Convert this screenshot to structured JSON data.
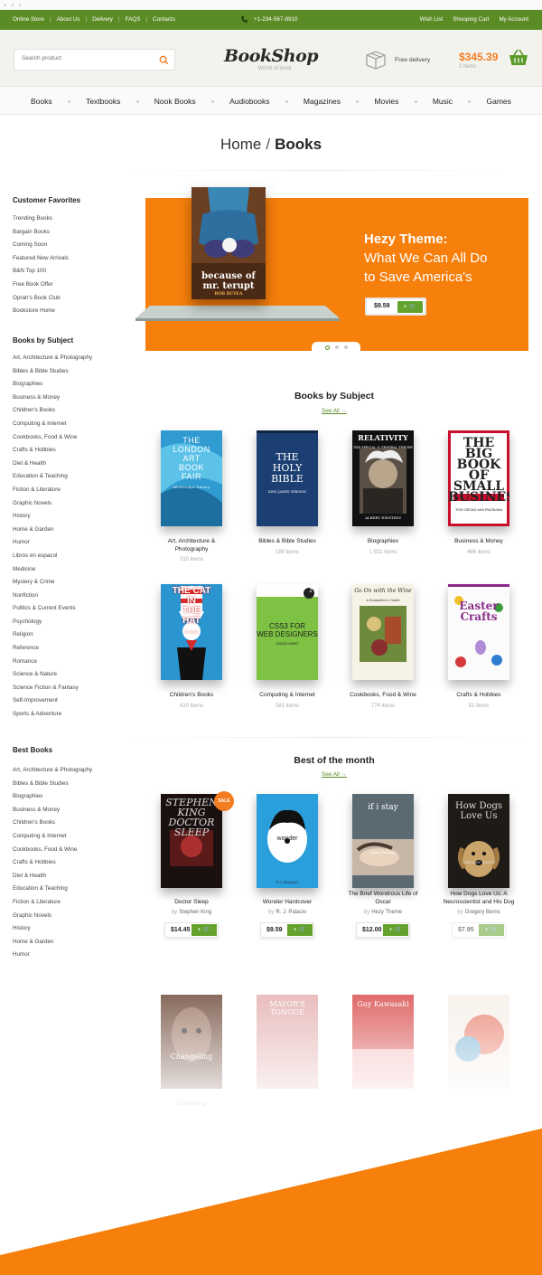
{
  "topbar": {
    "links": [
      "Online Store",
      "About Us",
      "Delivery",
      "FAQS",
      "Contacts"
    ],
    "phone": "+1-234-567-8910",
    "account_links": [
      "Wish List",
      "Shooping Cart",
      "My Account"
    ]
  },
  "header": {
    "search_placeholder": "Search product",
    "logo": "BookShop",
    "tagline": "World of book",
    "delivery_text": "Free delivery",
    "cart_total": "$345.39",
    "cart_count": "2 items"
  },
  "nav": [
    "Books",
    "Textbooks",
    "Nook Books",
    "Audiobooks",
    "Magazines",
    "Movies",
    "Music",
    "Games"
  ],
  "breadcrumb": {
    "home": "Home",
    "separator": "/",
    "current": "Books"
  },
  "sidebar": {
    "customer_favorites": {
      "title": "Customer Favorites",
      "items": [
        "Trending Books",
        "Bargain Books",
        "Coming Soon",
        "Featured New Arrivals",
        "B&N Top 100",
        "Free Book Offer",
        "Oprah's Book Club",
        "Bookstore Home"
      ]
    },
    "books_by_subject": {
      "title": "Books by Subject",
      "items": [
        "Art, Architecture & Photography",
        "Bibles & Bible Studies",
        "Biographies",
        "Business & Money",
        "Children's Books",
        "Computing & Internet",
        "Cookbooks, Food & Wine",
        "Crafts & Hobbies",
        "Diet & Health",
        "Education & Teaching",
        "Fiction & Literature",
        "Graphic Novels",
        "History",
        "Home & Garden",
        "Humor",
        "Libros en espacol",
        "Medicine",
        "Mystery & Crime",
        "Nonfiction",
        "Politics & Current Events",
        "Psychology",
        "Religion",
        "Reference",
        "Romance",
        "Science & Nature",
        "Science Fiction & Fantasy",
        "Self-Improvement",
        "Sports & Adventure"
      ]
    },
    "best_books": {
      "title": "Best Books",
      "items": [
        "Art, Architecture & Photography",
        "Bibles & Bible Studies",
        "Biographies",
        "Business & Money",
        "Children's Books",
        "Computing & Internet",
        "Cookbooks, Food & Wine",
        "Crafts & Hobbies",
        "Diet & Health",
        "Education & Teaching",
        "Fiction & Literature",
        "Graphic Novels",
        "History",
        "Home & Garden",
        "Humor"
      ]
    }
  },
  "banner": {
    "title": "Hezy Theme:",
    "subtitle_line1": "What We Can All Do",
    "subtitle_line2": "to Save America's",
    "price": "$9.59",
    "add_label": "+ 🛒",
    "book_title_line1": "because of",
    "book_title_line2": "mr. terupt",
    "book_author": "ROB BUYEA"
  },
  "subjects_section": {
    "title": "Books by Subject",
    "see_all": "See All →",
    "items": [
      {
        "title": "Art, Architecture & Photography",
        "count": "310 items",
        "cover_text": [
          "THE",
          "LONDON",
          "ART",
          "BOOK",
          "FAIR"
        ],
        "cover_sub": "Whitechapel Gallery"
      },
      {
        "title": "Bibles & Bible Studies",
        "count": "199 items",
        "cover_text": [
          "THE",
          "HOLY",
          "BIBLE"
        ],
        "cover_sub": "KING JAMES VERSION"
      },
      {
        "title": "Biographies",
        "count": "1 921 items",
        "cover_text": [
          "RELATIVITY"
        ],
        "cover_sub": "THE SPECIAL & GENERAL THEORY",
        "cover_author": "ALBERT EINSTEIN"
      },
      {
        "title": "Business & Money",
        "count": "466 items",
        "cover_text": [
          "THE",
          "BIG",
          "BOOK",
          "OF SMALL",
          "BUSINESS"
        ],
        "cover_sub": "TOM GEGAX with Phil Bolsta"
      },
      {
        "title": "Children's Books",
        "count": "410 items",
        "cover_text": [
          "THE CAT",
          "IN",
          "THE",
          "HAT"
        ],
        "cover_sub": "Dr. Seuss"
      },
      {
        "title": "Computing & Internet",
        "count": "281 items",
        "cover_text": [
          "CSS3 FOR",
          "WEB DESIGNERS"
        ],
        "cover_sub": "A BOOK APART",
        "cover_badge": "2"
      },
      {
        "title": "Cookbooks, Food & Wine",
        "count": "774 items",
        "cover_text": [
          "Go On with the Wine"
        ],
        "cover_sub": "A Sommelier's Guide"
      },
      {
        "title": "Crafts & Hobbies",
        "count": "51 items",
        "cover_text": [
          "Easter",
          "Crafts"
        ],
        "cover_sub": ""
      }
    ]
  },
  "best_section": {
    "title": "Best of the month",
    "see_all": "See All →",
    "sale_badge": "SALE",
    "by_label": "by",
    "add_label": "+ 🛒",
    "items": [
      {
        "title": "Doctor Sleep",
        "author": "Stephen King",
        "price": "$14.45",
        "cover_text": [
          "STEPHEN",
          "KING",
          "DOCTOR",
          "SLEEP"
        ]
      },
      {
        "title": "Wonder Hardcover",
        "author": "R. J. Palacio",
        "price": "$9.59",
        "cover_text": [
          "wonder"
        ],
        "cover_sub": "R.J. PALACIO"
      },
      {
        "title": "The Brief Wondrous Life of Oscar",
        "author": "Hezy Theme",
        "price": "$12.00",
        "cover_text": [
          "if i stay"
        ],
        "cover_sub": "Gayle Forman"
      },
      {
        "title": "How Dogs Love Us: A Neuroscientist and His Dog",
        "author": "Gregory Berns",
        "price": "$7.95",
        "cover_text": [
          "How Dogs",
          "Love Us"
        ],
        "cover_sub": "GREGORY BERNS"
      }
    ]
  },
  "faded_row": {
    "items": [
      {
        "title": "Changeling",
        "cover_text": [
          "Changeling"
        ]
      },
      {
        "title": "",
        "cover_text": [
          "MAYOR'S",
          "TONGUE"
        ]
      },
      {
        "title": "",
        "cover_text": [
          "Guy Kawasaki"
        ]
      },
      {
        "title": "",
        "cover_text": [
          ""
        ]
      }
    ]
  },
  "colors": {
    "green": "#5a8b25",
    "orange": "#f77f0b",
    "button_green": "#63a22c"
  }
}
